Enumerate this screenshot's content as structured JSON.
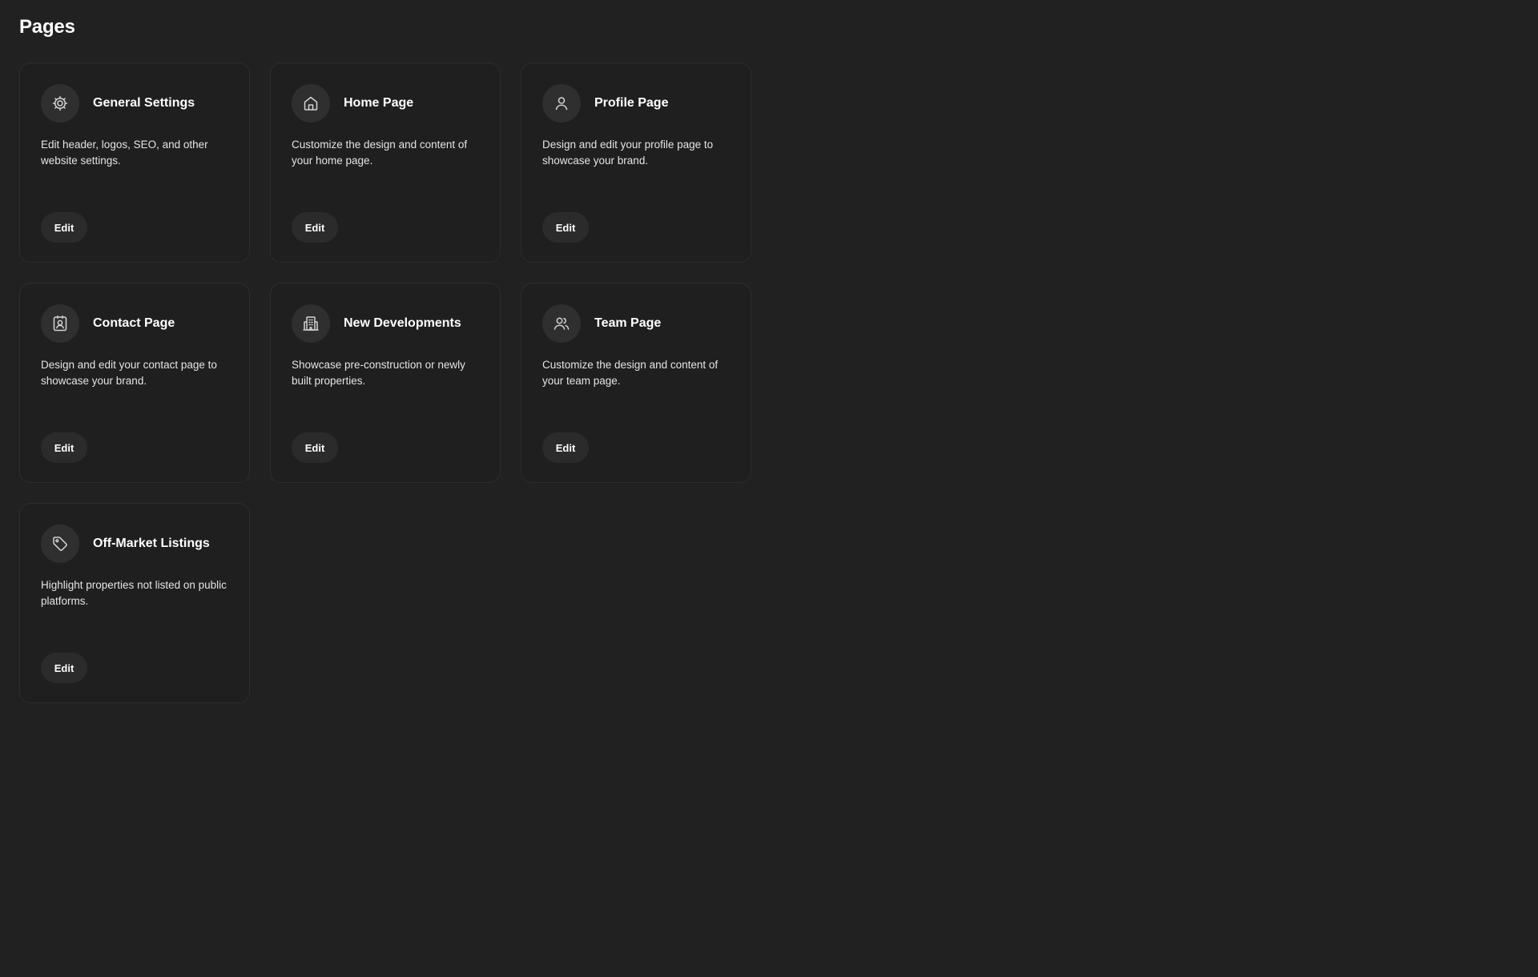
{
  "page_title": "Pages",
  "cards": [
    {
      "title": "General Settings",
      "icon": "gear-icon",
      "description": "Edit header, logos, SEO, and other website settings.",
      "edit_label": "Edit"
    },
    {
      "title": "Home Page",
      "icon": "home-icon",
      "description": "Customize the design and content of your home page.",
      "edit_label": "Edit"
    },
    {
      "title": "Profile Page",
      "icon": "user-icon",
      "description": "Design and edit your profile page to showcase your brand.",
      "edit_label": "Edit"
    },
    {
      "title": "Contact Page",
      "icon": "contact-card-icon",
      "description": "Design and edit your contact page to showcase your brand.",
      "edit_label": "Edit"
    },
    {
      "title": "New Developments",
      "icon": "building-icon",
      "description": "Showcase pre-construction or newly built properties.",
      "edit_label": "Edit"
    },
    {
      "title": "Team Page",
      "icon": "users-icon",
      "description": "Customize the design and content of your team page.",
      "edit_label": "Edit"
    },
    {
      "title": "Off-Market Listings",
      "icon": "tag-icon",
      "description": "Highlight properties not listed on public platforms.",
      "edit_label": "Edit"
    }
  ],
  "colors": {
    "background": "#212121",
    "card_background": "#1f1f1f",
    "card_border": "#2c2c2c",
    "icon_circle": "#2f2f2f",
    "button_background": "#2b2b2b",
    "text": "#ffffff"
  }
}
